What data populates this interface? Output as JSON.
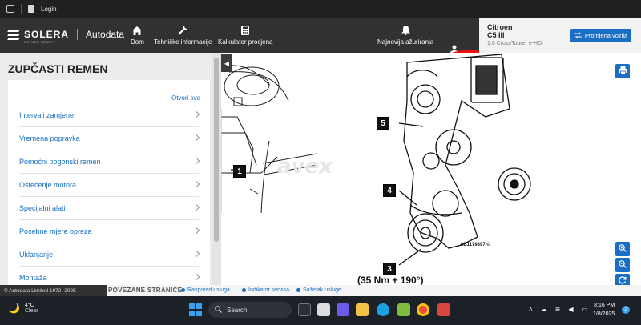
{
  "browser": {
    "tab_label": "Login"
  },
  "header": {
    "brand": "SOLERA",
    "brand_sub": "FUTURE READY",
    "product": "Autodata",
    "nav": [
      {
        "label": "Dom",
        "icon": "home-icon"
      },
      {
        "label": "Tehničke informacije",
        "icon": "wrench-icon"
      },
      {
        "label": "Kalkulator procjena",
        "icon": "calculator-icon"
      },
      {
        "label": "Najnovija ažuriranja",
        "icon": "bell-icon"
      }
    ]
  },
  "vehicle": {
    "make": "Citroen",
    "model": "C5 III",
    "variant": "1.6 CrossTourer e-HDi",
    "change_button": "Promjena vozila"
  },
  "left_panel": {
    "title": "ZUPČASTI REMEN",
    "open_all": "Otvori sve",
    "items": [
      "Intervali zamjene",
      "Vremena popravka",
      "Pomoćni pogonski remen",
      "Oštećenje motora",
      "Specijalni alati",
      "Posebne mjere opreza",
      "Uklanjanje",
      "Montaža"
    ]
  },
  "diagram": {
    "callouts": [
      "1",
      "5",
      "4",
      "3"
    ],
    "torque_label": "(35 Nm + 190°)",
    "reference_code": "AB1179397 ©"
  },
  "footer": {
    "copyright": "© Autodata Limited 1972- 2025",
    "related_title": "POVEZANE STRANICE",
    "related_links": [
      "Raspored usluga",
      "Indikator servisa",
      "Sažetak usluge"
    ]
  },
  "taskbar": {
    "weather_temp": "4°C",
    "weather_cond": "Clear",
    "search_placeholder": "Search",
    "time": "8:16 PM",
    "date": "1/8/2025",
    "notification_count": "2"
  },
  "colors": {
    "accent": "#1a6fc4",
    "header_bg": "#2f3133",
    "redaction": "#e11111"
  }
}
